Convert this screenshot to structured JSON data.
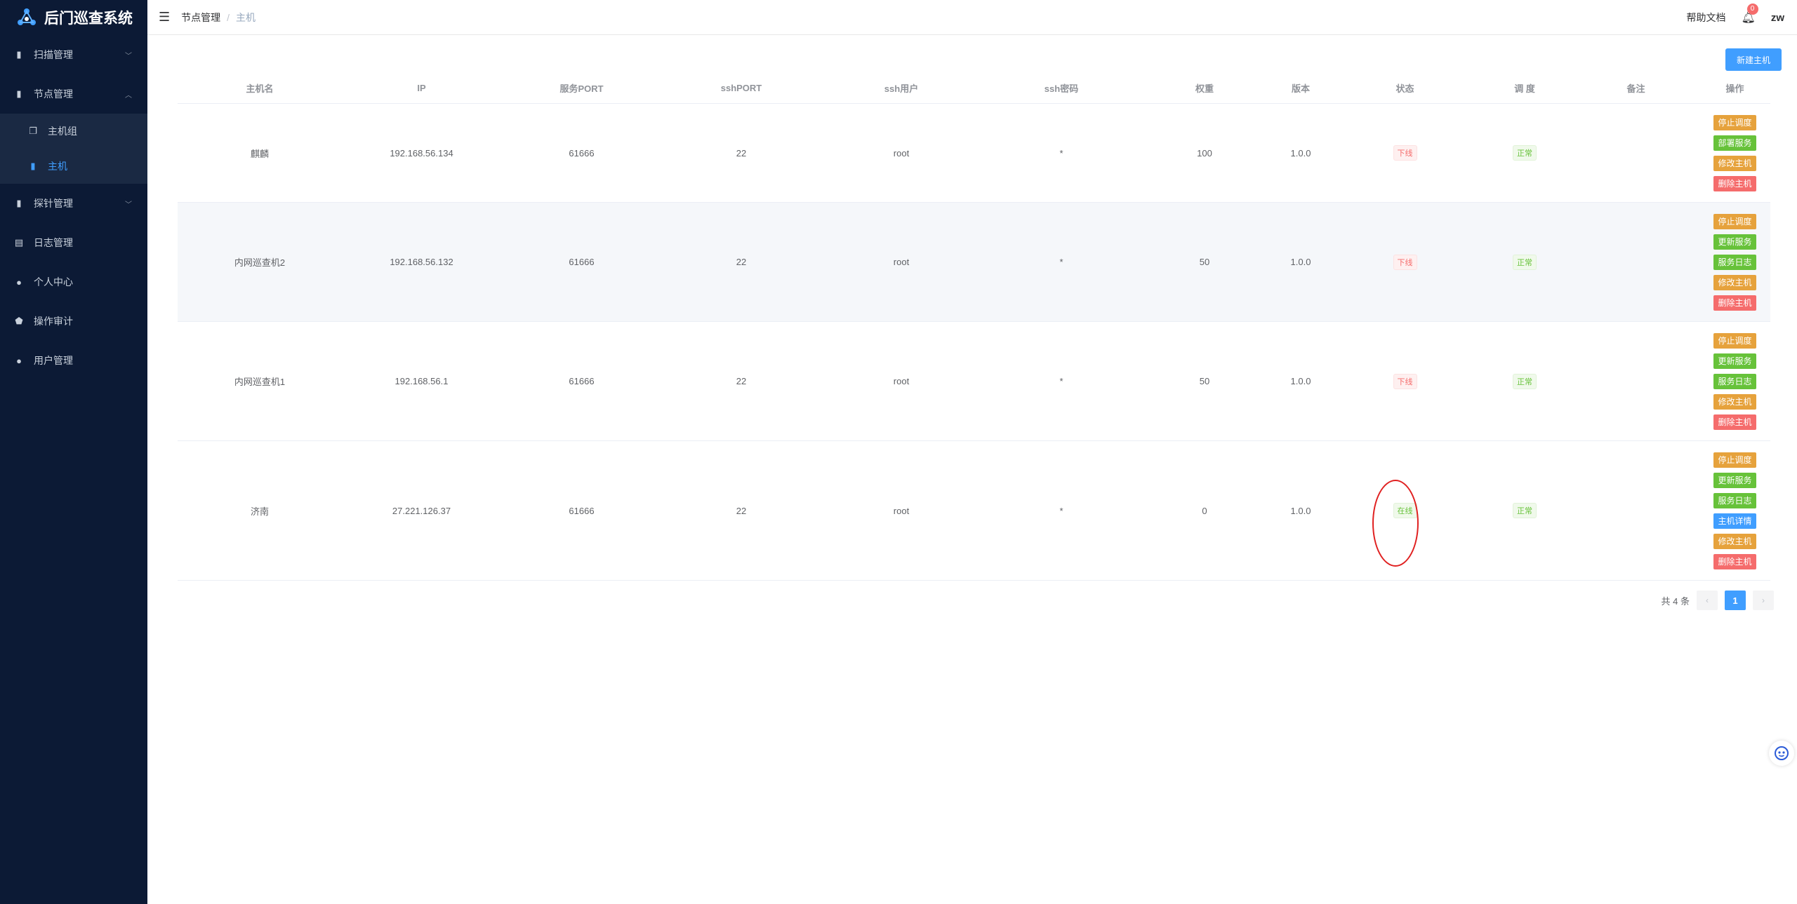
{
  "app": {
    "title": "后门巡查系统"
  },
  "sidebar": {
    "items": [
      {
        "label": "扫描管理"
      },
      {
        "label": "节点管理"
      },
      {
        "label": "主机组"
      },
      {
        "label": "主机"
      },
      {
        "label": "探针管理"
      },
      {
        "label": "日志管理"
      },
      {
        "label": "个人中心"
      },
      {
        "label": "操作审计"
      },
      {
        "label": "用户管理"
      }
    ]
  },
  "header": {
    "breadcrumb": [
      "节点管理",
      "主机"
    ],
    "breadcrumb_sep": "/",
    "help": "帮助文档",
    "notify_count": "0",
    "user": "zw"
  },
  "toolbar": {
    "new_host": "新建主机"
  },
  "table": {
    "headers": [
      "主机名",
      "IP",
      "服务PORT",
      "sshPORT",
      "ssh用户",
      "ssh密码",
      "权重",
      "版本",
      "状态",
      "调 度",
      "备注",
      "操作"
    ],
    "rows": [
      {
        "name": "麒麟",
        "ip": "192.168.56.134",
        "port": "61666",
        "ssh_port": "22",
        "ssh_user": "root",
        "ssh_pwd": "*",
        "weight": "100",
        "version": "1.0.0",
        "status": "下线",
        "schedule": "正常",
        "remark": "",
        "ops": [
          "停止调度",
          "部署服务",
          "修改主机",
          "删除主机"
        ]
      },
      {
        "name": "内网巡查机2",
        "ip": "192.168.56.132",
        "port": "61666",
        "ssh_port": "22",
        "ssh_user": "root",
        "ssh_pwd": "*",
        "weight": "50",
        "version": "1.0.0",
        "status": "下线",
        "schedule": "正常",
        "remark": "",
        "ops": [
          "停止调度",
          "更新服务",
          "服务日志",
          "修改主机",
          "删除主机"
        ]
      },
      {
        "name": "内网巡查机1",
        "ip": "192.168.56.1",
        "port": "61666",
        "ssh_port": "22",
        "ssh_user": "root",
        "ssh_pwd": "*",
        "weight": "50",
        "version": "1.0.0",
        "status": "下线",
        "schedule": "正常",
        "remark": "",
        "ops": [
          "停止调度",
          "更新服务",
          "服务日志",
          "修改主机",
          "删除主机"
        ]
      },
      {
        "name": "济南",
        "ip": "27.221.126.37",
        "port": "61666",
        "ssh_port": "22",
        "ssh_user": "root",
        "ssh_pwd": "*",
        "weight": "0",
        "version": "1.0.0",
        "status": "在线",
        "schedule": "正常",
        "remark": "",
        "ops": [
          "停止调度",
          "更新服务",
          "服务日志",
          "主机详情",
          "修改主机",
          "删除主机"
        ]
      }
    ]
  },
  "pagination": {
    "total": "共 4 条",
    "current": "1",
    "prev": "‹",
    "next": "›"
  },
  "colors": {
    "sidebar_bg": "#0c1a35",
    "primary": "#409eff",
    "success": "#67c23a",
    "warning": "#e6a23c",
    "danger": "#f56c6c",
    "annotation": "#e02020"
  }
}
